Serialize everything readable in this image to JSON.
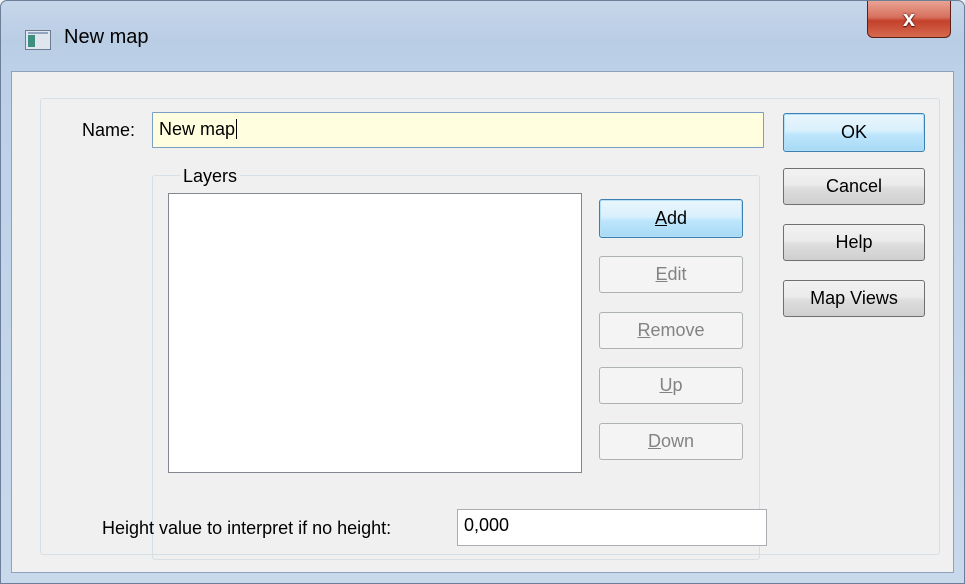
{
  "window": {
    "title": "New map",
    "close_glyph": "x",
    "icon": "window-app-icon"
  },
  "form": {
    "name_label": "Name:",
    "name_value": "New map",
    "layers_caption": "Layers",
    "layers_items": [],
    "height_label": "Height value to interpret if no height:",
    "height_value": "0,000"
  },
  "layer_buttons": {
    "add": {
      "pre": "",
      "key": "A",
      "post": "dd"
    },
    "edit": {
      "pre": "",
      "key": "E",
      "post": "dit"
    },
    "remove": {
      "pre": "",
      "key": "R",
      "post": "emove"
    },
    "up": {
      "pre": "",
      "key": "U",
      "post": "p"
    },
    "down": {
      "pre": "",
      "key": "D",
      "post": "own"
    }
  },
  "dialog_buttons": {
    "ok": "OK",
    "cancel": "Cancel",
    "help": "Help",
    "map_views": "Map Views"
  }
}
